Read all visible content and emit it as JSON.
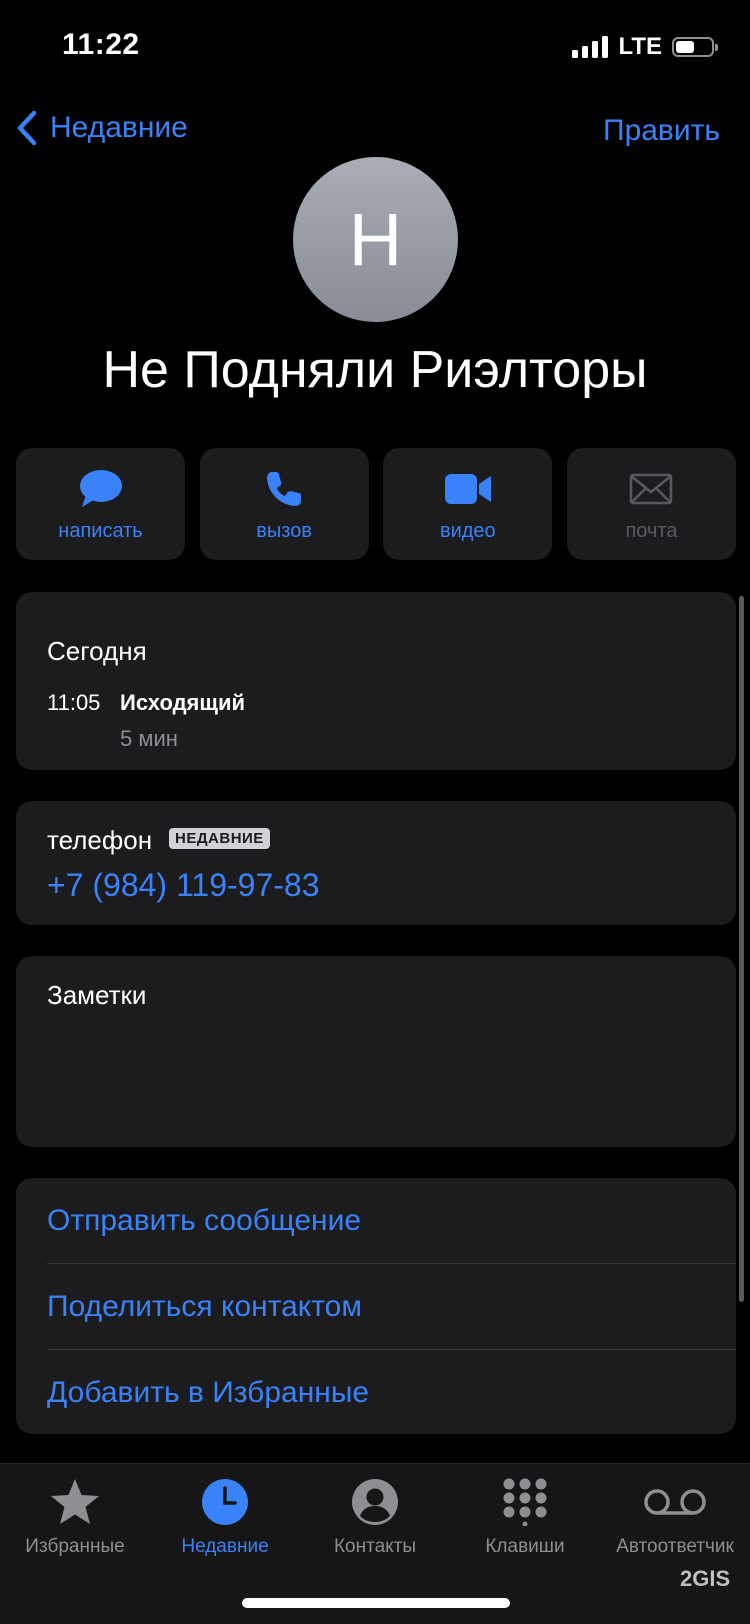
{
  "status_bar": {
    "time": "11:22",
    "network": "LTE"
  },
  "nav": {
    "back_label": "Недавние",
    "edit_label": "Править"
  },
  "contact": {
    "avatar_initial": "Н",
    "name": "Не Подняли Риэлторы"
  },
  "actions": [
    {
      "label": "написать",
      "icon": "message-bubble-icon",
      "enabled": true
    },
    {
      "label": "вызов",
      "icon": "phone-icon",
      "enabled": true
    },
    {
      "label": "видео",
      "icon": "video-camera-icon",
      "enabled": true
    },
    {
      "label": "почта",
      "icon": "mail-envelope-icon",
      "enabled": false
    }
  ],
  "recent_call": {
    "day": "Сегодня",
    "time": "11:05",
    "type": "Исходящий",
    "duration": "5 мин"
  },
  "phone": {
    "label": "телефон",
    "badge": "НЕДАВНИЕ",
    "number": "+7 (984) 119-97-83"
  },
  "notes": {
    "label": "Заметки"
  },
  "links": [
    {
      "label": "Отправить сообщение"
    },
    {
      "label": "Поделиться контактом"
    },
    {
      "label": "Добавить в Избранные"
    }
  ],
  "tabs": [
    {
      "label": "Избранные",
      "icon": "star-icon",
      "active": false
    },
    {
      "label": "Недавние",
      "icon": "clock-icon",
      "active": true
    },
    {
      "label": "Контакты",
      "icon": "person-circle-icon",
      "active": false
    },
    {
      "label": "Клавиши",
      "icon": "keypad-icon",
      "active": false
    },
    {
      "label": "Автоответчик",
      "icon": "voicemail-icon",
      "active": false
    }
  ],
  "watermark": "2GIS",
  "colors": {
    "accent": "#3a82f7",
    "card_bg": "#1c1c1e",
    "secondary_text": "#8e8e93",
    "disabled": "#5a5a5e"
  }
}
